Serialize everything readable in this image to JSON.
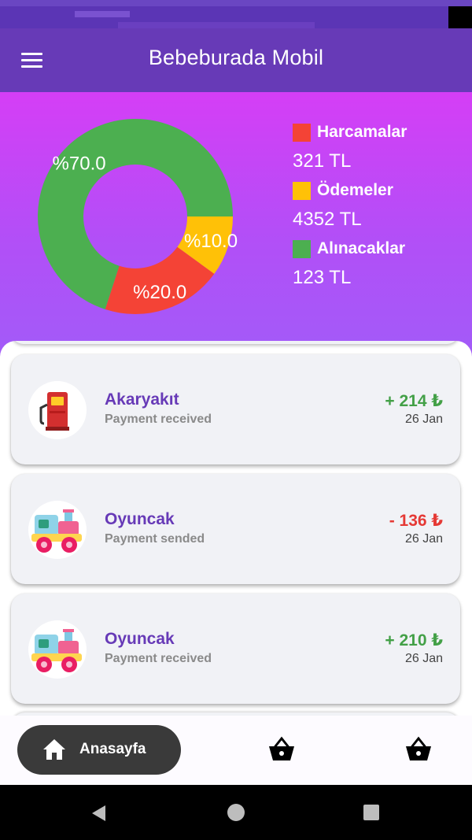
{
  "app": {
    "title": "Bebeburada Mobil"
  },
  "icons": {
    "menu": "hamburger-menu-icon",
    "home": "home-icon",
    "basket": "shopping-basket-icon",
    "fuel": "fuel-pump-icon",
    "toy": "toy-train-icon"
  },
  "colors": {
    "header": "#673ab7",
    "hero_top": "#d53ef6",
    "hero_bottom": "#a25bf8",
    "positive": "#43a047",
    "negative": "#e53935",
    "accent_title": "#673ab7"
  },
  "summary": {
    "legend": [
      {
        "name": "Harcamalar",
        "value": "321 TL",
        "color": "#f44336"
      },
      {
        "name": "Ödemeler",
        "value": "4352 TL",
        "color": "#ffc107"
      },
      {
        "name": "Alınacaklar",
        "value": "123 TL",
        "color": "#4caf50"
      }
    ]
  },
  "chart_data": {
    "type": "pie",
    "variant": "donut",
    "slices": [
      {
        "label": "%70.0",
        "value": 70,
        "color": "#4caf50"
      },
      {
        "label": "%10.0",
        "value": 10,
        "color": "#ffc107"
      },
      {
        "label": "%20.0",
        "value": 20,
        "color": "#f44336"
      }
    ]
  },
  "transactions": [
    {
      "title": "Akaryakıt",
      "subtitle": "Payment received",
      "amount": "+ 214 ₺",
      "date": "26 Jan",
      "direction": "in",
      "icon": "fuel-pump-icon"
    },
    {
      "title": "Oyuncak",
      "subtitle": "Payment sended",
      "amount": "- 136 ₺",
      "date": "26 Jan",
      "direction": "out",
      "icon": "toy-train-icon"
    },
    {
      "title": "Oyuncak",
      "subtitle": "Payment received",
      "amount": "+ 210 ₺",
      "date": "26 Jan",
      "direction": "in",
      "icon": "toy-train-icon"
    }
  ],
  "nav": {
    "home_label": "Anasayfa"
  }
}
